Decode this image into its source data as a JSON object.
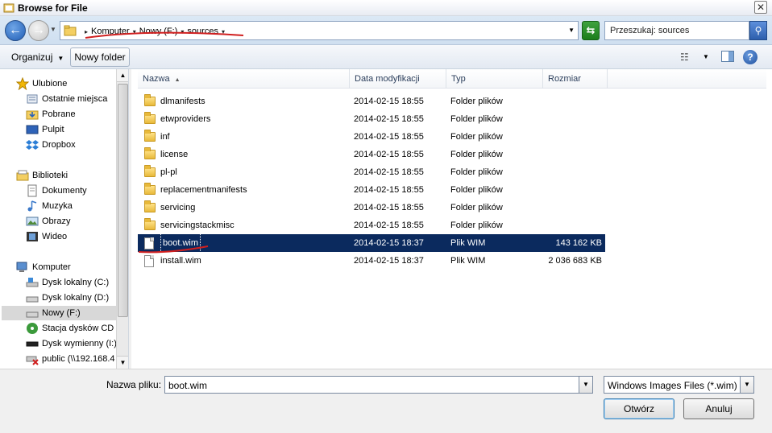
{
  "window": {
    "title": "Browse for File",
    "close_glyph": "✕"
  },
  "address": {
    "crumbs": [
      "Komputer",
      "Nowy (F:)",
      "sources"
    ],
    "search_placeholder": "Przeszukaj: sources"
  },
  "toolbar": {
    "organize_label": "Organizuj",
    "new_folder_label": "Nowy folder"
  },
  "nav": {
    "favorites": {
      "label": "Ulubione",
      "items": [
        "Ostatnie miejsca",
        "Pobrane",
        "Pulpit",
        "Dropbox"
      ]
    },
    "libraries": {
      "label": "Biblioteki",
      "items": [
        "Dokumenty",
        "Muzyka",
        "Obrazy",
        "Wideo"
      ]
    },
    "computer": {
      "label": "Komputer",
      "items": [
        "Dysk lokalny (C:)",
        "Dysk lokalny (D:)",
        "Nowy (F:)",
        "Stacja dysków CD (",
        "Dysk wymienny (I:)",
        "public (\\\\192.168.4"
      ],
      "selected": "Nowy (F:)"
    }
  },
  "columns": [
    "Nazwa",
    "Data modyfikacji",
    "Typ",
    "Rozmiar"
  ],
  "files": [
    {
      "name": "dlmanifests",
      "date": "2014-02-15 18:55",
      "type": "Folder plików",
      "size": "",
      "kind": "folder"
    },
    {
      "name": "etwproviders",
      "date": "2014-02-15 18:55",
      "type": "Folder plików",
      "size": "",
      "kind": "folder"
    },
    {
      "name": "inf",
      "date": "2014-02-15 18:55",
      "type": "Folder plików",
      "size": "",
      "kind": "folder"
    },
    {
      "name": "license",
      "date": "2014-02-15 18:55",
      "type": "Folder plików",
      "size": "",
      "kind": "folder"
    },
    {
      "name": "pl-pl",
      "date": "2014-02-15 18:55",
      "type": "Folder plików",
      "size": "",
      "kind": "folder"
    },
    {
      "name": "replacementmanifests",
      "date": "2014-02-15 18:55",
      "type": "Folder plików",
      "size": "",
      "kind": "folder"
    },
    {
      "name": "servicing",
      "date": "2014-02-15 18:55",
      "type": "Folder plików",
      "size": "",
      "kind": "folder"
    },
    {
      "name": "servicingstackmisc",
      "date": "2014-02-15 18:55",
      "type": "Folder plików",
      "size": "",
      "kind": "folder"
    },
    {
      "name": "boot.wim",
      "date": "2014-02-15 18:37",
      "type": "Plik WIM",
      "size": "143 162 KB",
      "kind": "file",
      "selected": true
    },
    {
      "name": "install.wim",
      "date": "2014-02-15 18:37",
      "type": "Plik WIM",
      "size": "2 036 683 KB",
      "kind": "file"
    }
  ],
  "bottom": {
    "filename_label": "Nazwa pliku:",
    "filename_value": "boot.wim",
    "filetype_value": "Windows Images Files (*.wim)",
    "open_label": "Otwórz",
    "cancel_label": "Anuluj"
  },
  "colors": {
    "selection": "#0b2a5e",
    "annotation": "#d01f1f",
    "accent": "#1f5db5"
  }
}
